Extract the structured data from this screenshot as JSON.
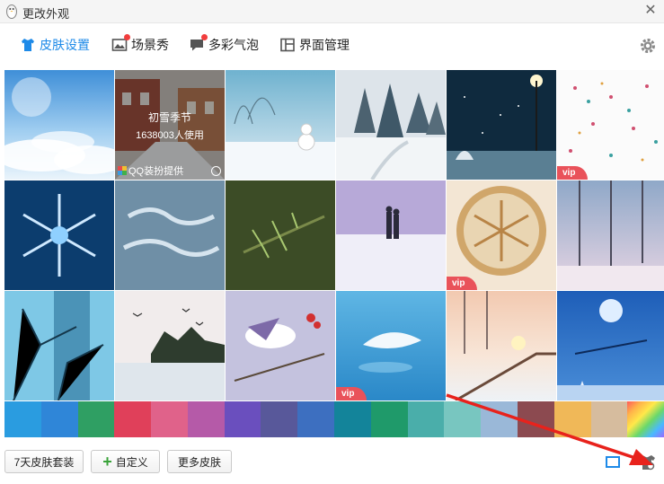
{
  "window": {
    "title": "更改外观"
  },
  "tabs": [
    {
      "label": "皮肤设置",
      "icon": "shirt-icon",
      "active": true,
      "badge": false
    },
    {
      "label": "场景秀",
      "icon": "picture-icon",
      "active": false,
      "badge": true
    },
    {
      "label": "多彩气泡",
      "icon": "chat-bubble-icon",
      "active": false,
      "badge": true
    },
    {
      "label": "界面管理",
      "icon": "layout-icon",
      "active": false,
      "badge": false
    }
  ],
  "skins": [
    {
      "theme": "sky-clouds",
      "vip": false
    },
    {
      "theme": "street-snow",
      "vip": false,
      "hovered": true
    },
    {
      "theme": "snowman",
      "vip": false
    },
    {
      "theme": "snowy-pines",
      "vip": false
    },
    {
      "theme": "night-snow-lamp",
      "vip": false
    },
    {
      "theme": "snowflake-pattern",
      "vip": true
    },
    {
      "theme": "ice-snowflake",
      "vip": false
    },
    {
      "theme": "merry-christmas-frost",
      "vip": false
    },
    {
      "theme": "pine-branch",
      "vip": false
    },
    {
      "theme": "couple-walking-snow",
      "vip": false
    },
    {
      "theme": "latte-snowflake",
      "vip": true
    },
    {
      "theme": "winter-trees-pink",
      "vip": false
    },
    {
      "theme": "frozen-branches",
      "vip": false
    },
    {
      "theme": "birds-lake",
      "vip": false
    },
    {
      "theme": "bird-on-branch",
      "vip": false
    },
    {
      "theme": "feather-water",
      "vip": true
    },
    {
      "theme": "snowy-bridge-sunset",
      "vip": false
    },
    {
      "theme": "moon-reindeer",
      "vip": false
    }
  ],
  "vip_label": "vip",
  "hover_overlay": {
    "name": "初雪季节",
    "users": "1638003人使用",
    "provider": "QQ装扮提供"
  },
  "colors": [
    "#2a9ce0",
    "#2f86d8",
    "#2f9f63",
    "#e0405a",
    "#e0628a",
    "#b55aa8",
    "#6a4fbe",
    "#58589a",
    "#3d6fc0",
    "#13849a",
    "#1f9a6a",
    "#4aaeaa",
    "#78c6c0",
    "#9ab8d8",
    "#8c4a50",
    "#f0b858",
    "#d6bc9e",
    "rainbow"
  ],
  "buttons": {
    "seven_day": "7天皮肤套装",
    "custom": "自定义",
    "more": "更多皮肤"
  },
  "bottom_icons": [
    "window-icon",
    "shirt-settings-icon"
  ]
}
